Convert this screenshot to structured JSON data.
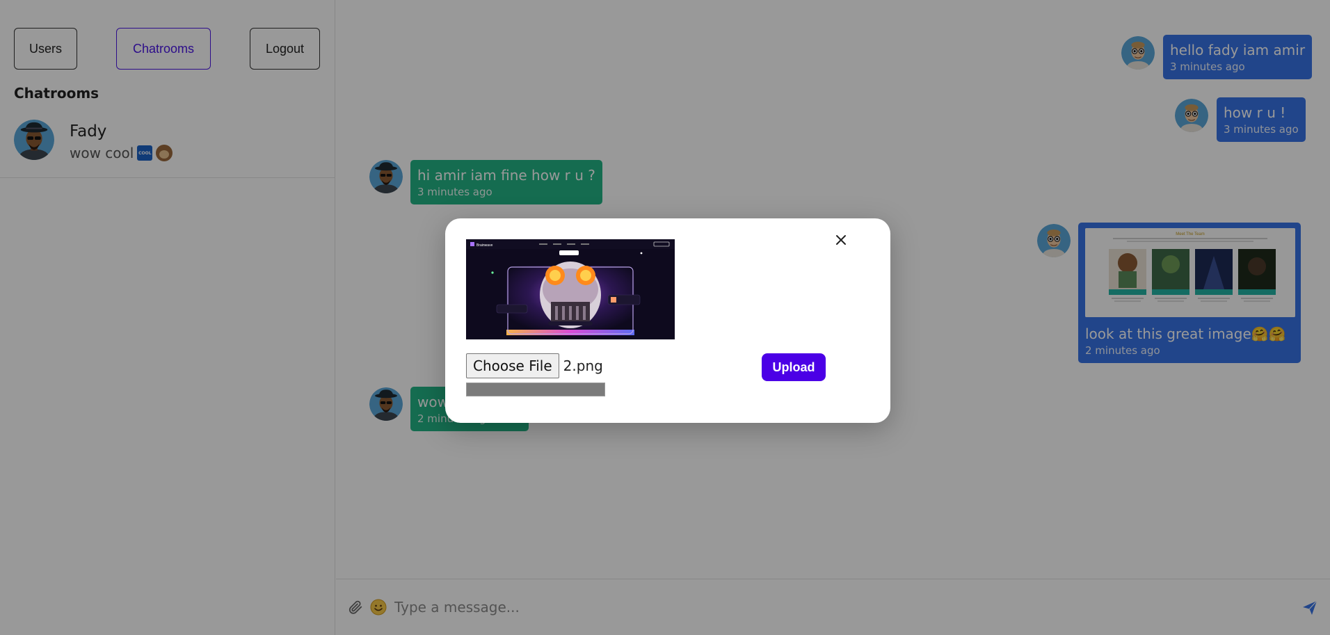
{
  "sidebar": {
    "buttons": {
      "users": "Users",
      "chatrooms": "Chatrooms",
      "logout": "Logout"
    },
    "heading": "Chatrooms",
    "chatrooms": [
      {
        "name": "Fady",
        "last_message": "wow cool",
        "emojis": [
          "cool-button-emoji",
          "monkey-emoji"
        ]
      }
    ]
  },
  "messages": [
    {
      "direction": "outgoing",
      "text": "hello fady iam amir",
      "time": "3 minutes ago"
    },
    {
      "direction": "outgoing",
      "text": "how r u !",
      "time": "3 minutes ago"
    },
    {
      "direction": "incoming",
      "text": "hi amir iam fine how r u ?",
      "time": "3 minutes ago"
    },
    {
      "direction": "outgoing",
      "text": "look at this great image🤗🤗",
      "time": "2 minutes ago",
      "image": {
        "heading": "Meet The Team"
      }
    },
    {
      "direction": "incoming",
      "text": "wow cool",
      "time": "2 minutes ago"
    }
  ],
  "composer": {
    "placeholder": "Type a message..."
  },
  "modal": {
    "choose_file_label": "Choose File",
    "file_name": "2.png",
    "upload_label": "Upload",
    "upload_progress": 1.0,
    "preview_brand": "Brainwave"
  },
  "colors": {
    "accent": "#4b00e6",
    "outgoing_bubble": "#3773e6",
    "incoming_bubble": "#23b585",
    "overlay": "rgba(0,0,0,0.40)"
  }
}
